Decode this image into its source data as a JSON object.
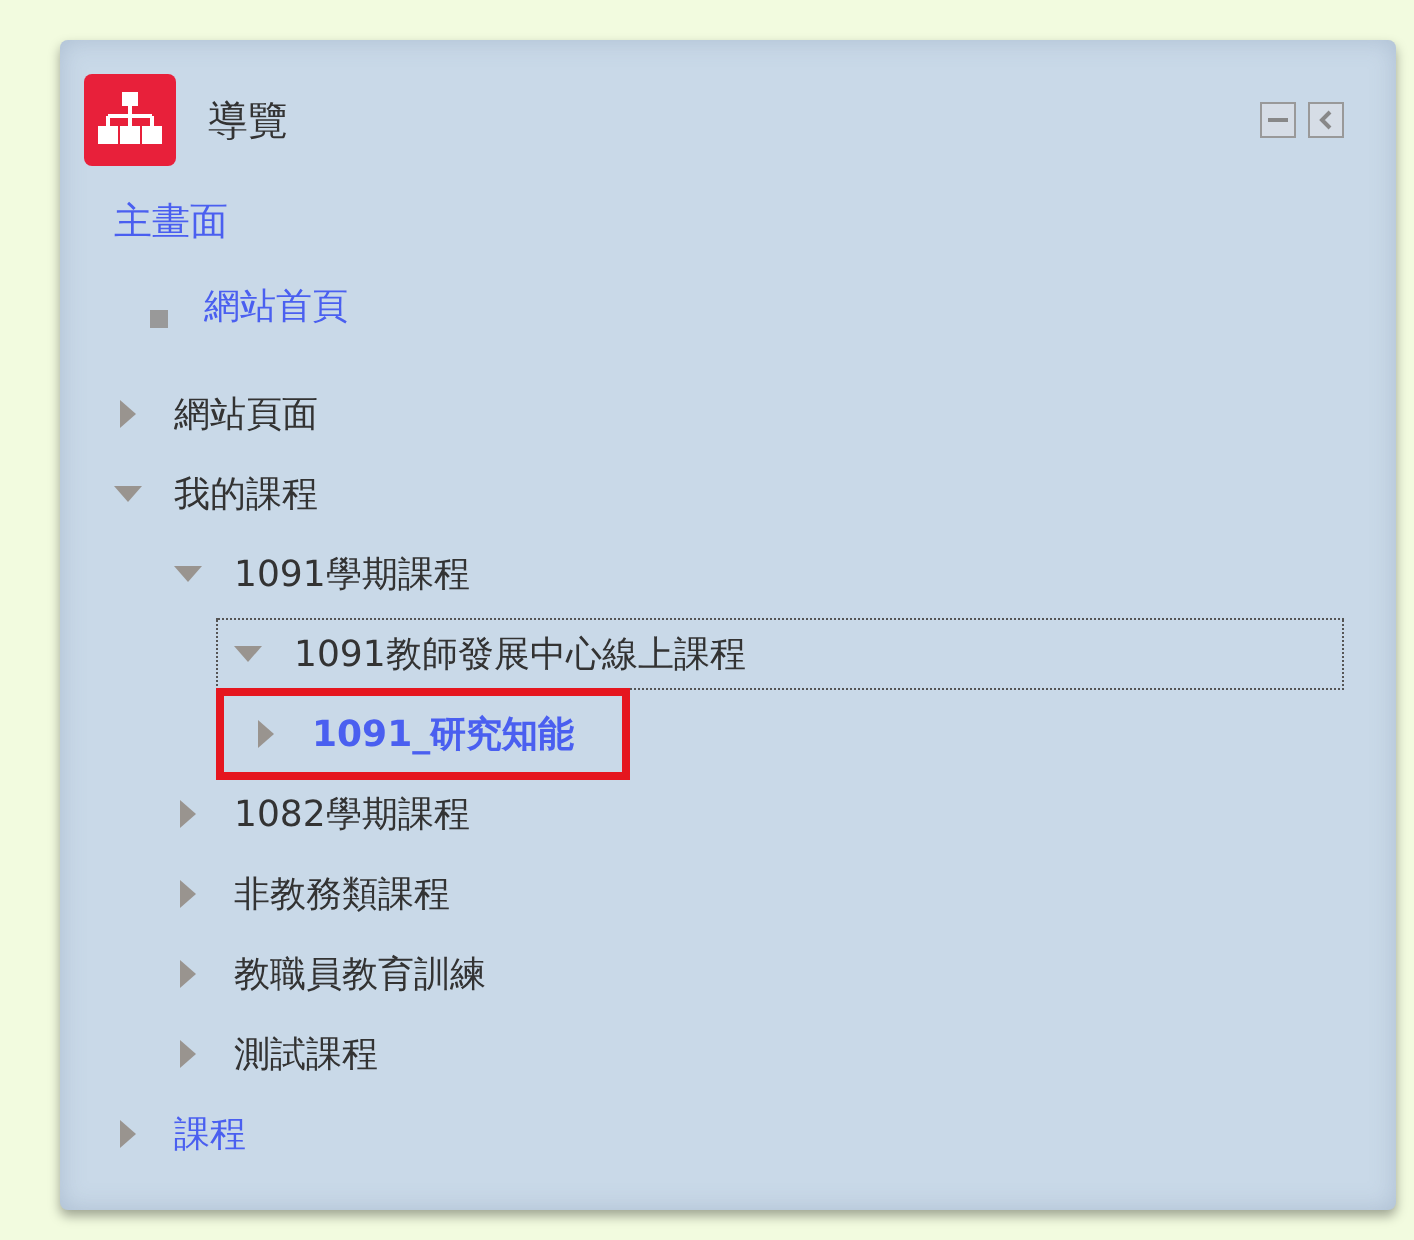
{
  "block": {
    "title": "導覽"
  },
  "tree": [
    {
      "label": "主畫面",
      "kind": "heading",
      "link": true,
      "children": [
        {
          "label": "網站首頁",
          "kind": "leaf",
          "link": true
        }
      ]
    },
    {
      "label": "網站頁面",
      "kind": "branch",
      "link": false,
      "expanded": false
    },
    {
      "label": "我的課程",
      "kind": "branch",
      "link": false,
      "expanded": true,
      "children": [
        {
          "label": "1091學期課程",
          "kind": "branch",
          "link": false,
          "expanded": true,
          "children": [
            {
              "label": "1091教師發展中心線上課程",
              "kind": "branch",
              "link": false,
              "expanded": true,
              "focused": true,
              "children": [
                {
                  "label": "1091_研究知能",
                  "kind": "branch",
                  "link": true,
                  "expanded": false,
                  "highlighted": true
                }
              ]
            }
          ]
        },
        {
          "label": "1082學期課程",
          "kind": "branch",
          "link": false,
          "expanded": false
        },
        {
          "label": "非教務類課程",
          "kind": "branch",
          "link": false,
          "expanded": false
        },
        {
          "label": "教職員教育訓練",
          "kind": "branch",
          "link": false,
          "expanded": false
        },
        {
          "label": "測試課程",
          "kind": "branch",
          "link": false,
          "expanded": false
        }
      ]
    },
    {
      "label": "課程",
      "kind": "branch",
      "link": true,
      "expanded": false
    }
  ]
}
